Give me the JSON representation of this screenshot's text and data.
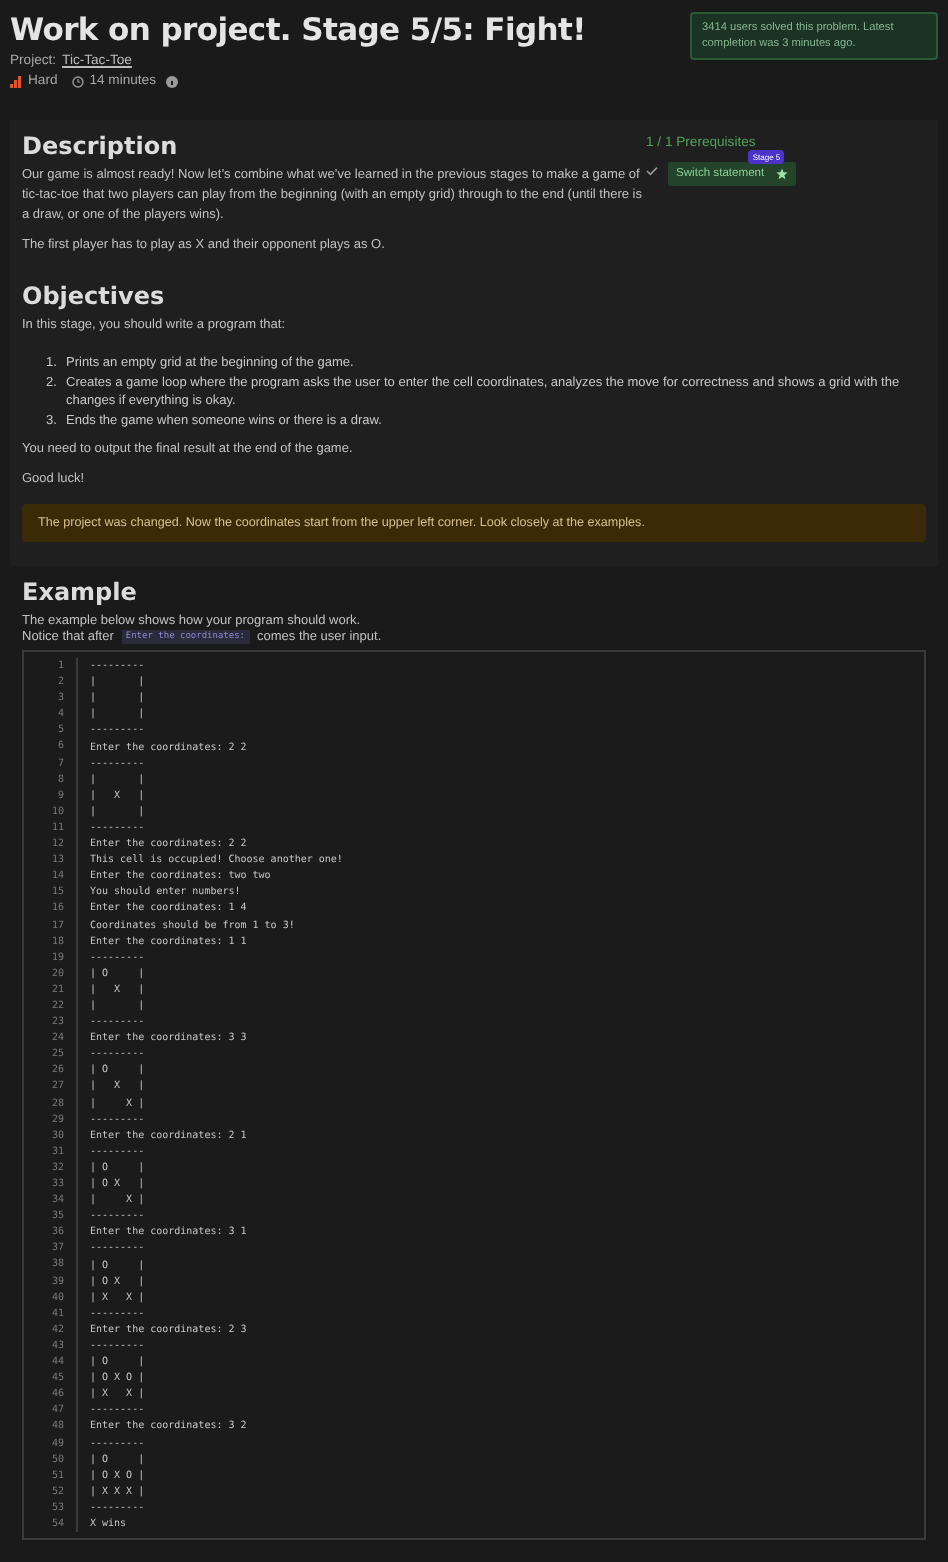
{
  "header": {
    "title": "Work on project. Stage 5/5: Fight!",
    "project_label": "Project:",
    "project_link": "Tic-Tac-Toe",
    "difficulty": "Hard",
    "time": "14 minutes",
    "stats": "3414 users solved this problem. Latest completion was 3 minutes ago."
  },
  "description": {
    "heading": "Description",
    "paragraphs": [
      "Our game is almost ready! Now let’s combine what we’ve learned in the previous stages to make a game of tic-tac-toe that two players can play from the beginning (with an empty grid) through to the end (until there is a draw, or one of the players wins).",
      "The first player has to play as X and their opponent plays as O."
    ]
  },
  "prerequisites": {
    "count": "1 / 1 Prerequisites",
    "items": [
      {
        "label": "Switch statement",
        "badge": "Stage 5",
        "completed": true
      }
    ]
  },
  "objectives": {
    "heading": "Objectives",
    "intro": "In this stage, you should write a program that:",
    "items": [
      {
        "number": "1.",
        "text": "Prints an empty grid at the beginning of the game."
      },
      {
        "number": "2.",
        "text": "Creates a game loop where the program asks the user to enter the cell coordinates, analyzes the move for correctness and shows a grid with the changes if everything is okay."
      },
      {
        "number": "3.",
        "text": "Ends the game when someone wins or there is a draw."
      }
    ],
    "paragraphs": [
      "You need to output the final result at the end of the game.",
      "Good luck!"
    ]
  },
  "notice": "The project was changed. Now the coordinates start from the upper left corner. Look closely at the examples.",
  "example": {
    "heading": "Example",
    "intro": "The example below shows how your program should work.",
    "notice_before": "Notice that after",
    "notice_code": "Enter the coordinates:",
    "notice_after": "comes the user input.",
    "code_lines": [
      {
        "n": "1",
        "text": "---------"
      },
      {
        "n": "2",
        "text": "|       |"
      },
      {
        "n": "3",
        "text": "|       |"
      },
      {
        "n": "4",
        "text": "|       |"
      },
      {
        "n": "5",
        "text": "---------"
      },
      {
        "n": "6",
        "text": "Enter the coordinates: 2 2"
      },
      {
        "n": "7",
        "text": "---------"
      },
      {
        "n": "8",
        "text": "|       |"
      },
      {
        "n": "9",
        "text": "|   X   |"
      },
      {
        "n": "10",
        "text": "|       |"
      },
      {
        "n": "11",
        "text": "---------"
      },
      {
        "n": "12",
        "text": "Enter the coordinates: 2 2"
      },
      {
        "n": "13",
        "text": "This cell is occupied! Choose another one!"
      },
      {
        "n": "14",
        "text": "Enter the coordinates: two two"
      },
      {
        "n": "15",
        "text": "You should enter numbers!"
      },
      {
        "n": "16",
        "text": "Enter the coordinates: 1 4"
      },
      {
        "n": "17",
        "text": "Coordinates should be from 1 to 3!"
      },
      {
        "n": "18",
        "text": "Enter the coordinates: 1 1"
      },
      {
        "n": "19",
        "text": "---------"
      },
      {
        "n": "20",
        "text": "| O     |"
      },
      {
        "n": "21",
        "text": "|   X   |"
      },
      {
        "n": "22",
        "text": "|       |"
      },
      {
        "n": "23",
        "text": "---------"
      },
      {
        "n": "24",
        "text": "Enter the coordinates: 3 3"
      },
      {
        "n": "25",
        "text": "---------"
      },
      {
        "n": "26",
        "text": "| O     |"
      },
      {
        "n": "27",
        "text": "|   X   |"
      },
      {
        "n": "28",
        "text": "|     X |"
      },
      {
        "n": "29",
        "text": "---------"
      },
      {
        "n": "30",
        "text": "Enter the coordinates: 2 1"
      },
      {
        "n": "31",
        "text": "---------"
      },
      {
        "n": "32",
        "text": "| O     |"
      },
      {
        "n": "33",
        "text": "| O X   |"
      },
      {
        "n": "34",
        "text": "|     X |"
      },
      {
        "n": "35",
        "text": "---------"
      },
      {
        "n": "36",
        "text": "Enter the coordinates: 3 1"
      },
      {
        "n": "37",
        "text": "---------"
      },
      {
        "n": "38",
        "text": "| O     |"
      },
      {
        "n": "39",
        "text": "| O X   |"
      },
      {
        "n": "40",
        "text": "| X   X |"
      },
      {
        "n": "41",
        "text": "---------"
      },
      {
        "n": "42",
        "text": "Enter the coordinates: 2 3"
      },
      {
        "n": "43",
        "text": "---------"
      },
      {
        "n": "44",
        "text": "| O     |"
      },
      {
        "n": "45",
        "text": "| O X O |"
      },
      {
        "n": "46",
        "text": "| X   X |"
      },
      {
        "n": "47",
        "text": "---------"
      },
      {
        "n": "48",
        "text": "Enter the coordinates: 3 2"
      },
      {
        "n": "49",
        "text": "---------"
      },
      {
        "n": "50",
        "text": "| O     |"
      },
      {
        "n": "51",
        "text": "| O X O |"
      },
      {
        "n": "52",
        "text": "| X X X |"
      },
      {
        "n": "53",
        "text": "---------"
      },
      {
        "n": "54",
        "text": "X wins"
      }
    ]
  }
}
